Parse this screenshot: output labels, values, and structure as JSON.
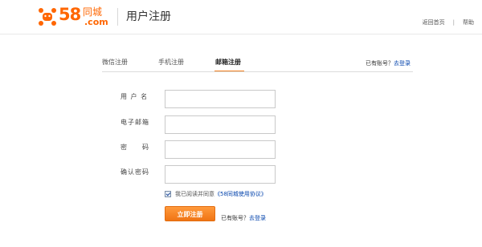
{
  "header": {
    "logo_number": "58",
    "logo_cn": "同城",
    "logo_com": ".com",
    "page_title": "用户注册",
    "links": [
      "返回首页",
      "|",
      "帮助"
    ]
  },
  "tabs": {
    "items": [
      "微信注册",
      "手机注册",
      "邮箱注册"
    ],
    "active_index": 2,
    "login_hint_prefix": "已有账号？",
    "login_link": "去登录"
  },
  "form": {
    "fields": [
      {
        "label": "用 户 名",
        "value": ""
      },
      {
        "label": "电子邮箱",
        "value": ""
      },
      {
        "label": "密　　码",
        "value": ""
      },
      {
        "label": "确认密码",
        "value": ""
      }
    ],
    "agree_checked": true,
    "agree_prefix": "我已阅读并同意",
    "agree_link": "《58同城使用协议》",
    "submit_label": "立即注册",
    "bottom_hint_prefix": "已有账号？",
    "bottom_login_link": "去登录"
  },
  "colors": {
    "brand_orange": "#ff6600",
    "tab_underline": "#f58220",
    "link_blue": "#0645ad"
  }
}
